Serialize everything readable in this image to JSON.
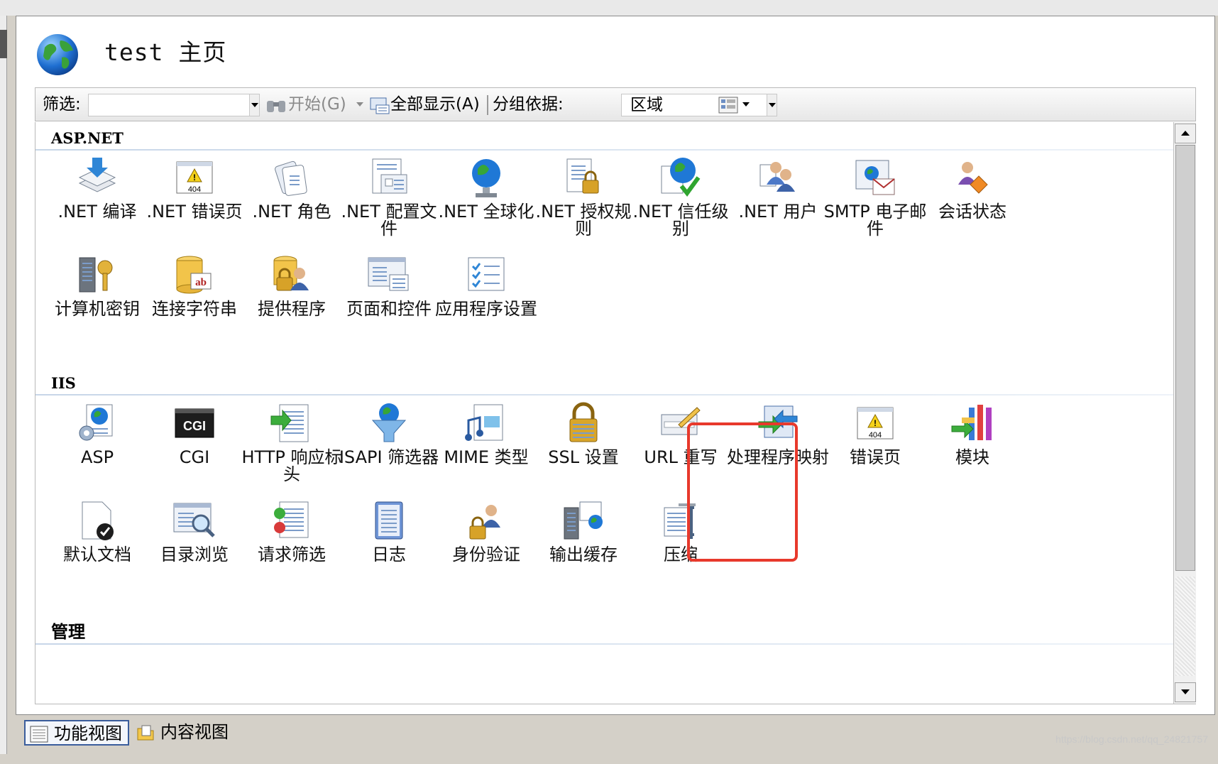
{
  "header": {
    "title": "test  主页"
  },
  "toolbar": {
    "filter_label": "筛选:",
    "filter_value": "",
    "start_label": "开始(G)",
    "show_all_label": "全部显示(A)",
    "group_label": "分组依据:",
    "group_value": "区域"
  },
  "sections": {
    "aspnet": {
      "title": "ASP.NET",
      "items": [
        {
          "label": ".NET 编译",
          "icon": "compile-icon"
        },
        {
          "label": ".NET 错误页",
          "icon": "error-page-icon"
        },
        {
          "label": ".NET 角色",
          "icon": "roles-icon"
        },
        {
          "label": ".NET 配置文件",
          "icon": "profile-icon"
        },
        {
          "label": ".NET 全球化",
          "icon": "globalization-icon"
        },
        {
          "label": ".NET 授权规则",
          "icon": "authorization-icon"
        },
        {
          "label": ".NET 信任级别",
          "icon": "trust-level-icon"
        },
        {
          "label": ".NET 用户",
          "icon": "users-icon"
        },
        {
          "label": "SMTP 电子邮件",
          "icon": "smtp-icon"
        },
        {
          "label": "会话状态",
          "icon": "session-state-icon"
        },
        {
          "label": "计算机密钥",
          "icon": "machine-key-icon"
        },
        {
          "label": "连接字符串",
          "icon": "connection-strings-icon"
        },
        {
          "label": "提供程序",
          "icon": "providers-icon"
        },
        {
          "label": "页面和控件",
          "icon": "pages-controls-icon"
        },
        {
          "label": "应用程序设置",
          "icon": "app-settings-icon"
        }
      ]
    },
    "iis": {
      "title": "IIS",
      "items": [
        {
          "label": "ASP",
          "icon": "asp-icon"
        },
        {
          "label": "CGI",
          "icon": "cgi-icon"
        },
        {
          "label": "HTTP 响应标头",
          "icon": "http-headers-icon"
        },
        {
          "label": "ISAPI 筛选器",
          "icon": "isapi-filter-icon"
        },
        {
          "label": "MIME 类型",
          "icon": "mime-types-icon"
        },
        {
          "label": "SSL 设置",
          "icon": "ssl-icon"
        },
        {
          "label": "URL 重写",
          "icon": "url-rewrite-icon"
        },
        {
          "label": "处理程序映射",
          "icon": "handler-mappings-icon"
        },
        {
          "label": "错误页",
          "icon": "error-pages-icon"
        },
        {
          "label": "模块",
          "icon": "modules-icon"
        },
        {
          "label": "默认文档",
          "icon": "default-document-icon"
        },
        {
          "label": "目录浏览",
          "icon": "directory-browsing-icon"
        },
        {
          "label": "请求筛选",
          "icon": "request-filtering-icon"
        },
        {
          "label": "日志",
          "icon": "logging-icon"
        },
        {
          "label": "身份验证",
          "icon": "authentication-icon"
        },
        {
          "label": "输出缓存",
          "icon": "output-caching-icon"
        },
        {
          "label": "压缩",
          "icon": "compression-icon"
        }
      ]
    },
    "manage": {
      "title": "管理"
    }
  },
  "footer": {
    "features_view": "功能视图",
    "content_view": "内容视图"
  },
  "colors": {
    "highlight": "#e8392c",
    "accent": "#3a5d9c"
  },
  "watermark": "https://blog.csdn.net/qq_24821757"
}
